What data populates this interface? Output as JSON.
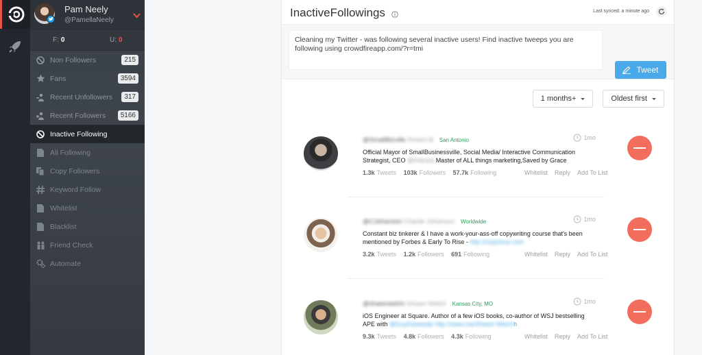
{
  "sidebar": {
    "profile": {
      "name": "Pam Neely",
      "handle": "@PamellaNeely"
    },
    "counts": {
      "f_label": "F:",
      "f_value": "0",
      "u_label": "U:",
      "u_value": "0"
    },
    "items": [
      {
        "label": "Non Followers",
        "badge": "215",
        "icon": "blocked-user-icon"
      },
      {
        "label": "Fans",
        "badge": "3594",
        "icon": "star-icon"
      },
      {
        "label": "Recent Unfollowers",
        "badge": "317",
        "icon": "user-minus-icon"
      },
      {
        "label": "Recent Followers",
        "badge": "5166",
        "icon": "user-plus-icon"
      },
      {
        "label": "Inactive Following",
        "badge": "",
        "icon": "ban-icon",
        "active": true
      },
      {
        "label": "All Following",
        "badge": "",
        "icon": "document-icon"
      },
      {
        "label": "Copy Followers",
        "badge": "",
        "icon": "copy-icon"
      },
      {
        "label": "Keyword Follow",
        "badge": "",
        "icon": "hashtag-icon"
      },
      {
        "label": "Whitelist",
        "badge": "",
        "icon": "whitelist-icon"
      },
      {
        "label": "Blacklist",
        "badge": "",
        "icon": "blacklist-icon"
      },
      {
        "label": "Friend Check",
        "badge": "",
        "icon": "friends-icon"
      },
      {
        "label": "Automate",
        "badge": "",
        "icon": "gears-icon"
      }
    ]
  },
  "header": {
    "title": "InactiveFollowings",
    "synced": "Last synced: a minute ago"
  },
  "compose": {
    "text": "Cleaning my Twitter - was following several inactive users! Find inactive tweeps you are following using crowdfireapp.com/?r=tmi",
    "tweet_label": "Tweet"
  },
  "filters": {
    "period": "1 months+",
    "sort": "Oldest first"
  },
  "users": [
    {
      "handle": "@SmallBizville",
      "realname": "Robert B",
      "location": "San Antonio",
      "time": "1mo",
      "bio_pre": "Official Mayor of SmallBusinessville, Social Media/ Interactive Communication Strategist, CEO ",
      "bio_blur": "@Interest",
      "bio_post": " Master of ALL things marketing,Saved by Grace",
      "tweets": "1.3k",
      "followers": "103k",
      "following": "57.7k"
    },
    {
      "handle": "@CJohanson",
      "realname": "Charlie Johanson",
      "location": "Worldwide",
      "time": "1mo",
      "bio_pre": "Constant biz tinkerer & I have a work-your-ass-off copywriting course that's been mentioned by Forbes & Early To Rise - ",
      "bio_blur": "http://copyhour.com",
      "bio_post": "",
      "tweets": "3.2k",
      "followers": "1.2k",
      "following": "691"
    },
    {
      "handle": "@shawnwelch",
      "realname": "Shawn Welch",
      "location": "Kansas City, MO",
      "time": "1mo",
      "bio_pre": "iOS Engineer at Square. Author of a few iOS books, co-author of WSJ bestselling APE with ",
      "bio_blur": "@GuyKawasaki http://www.me/Shawn-Welch",
      "bio_post": "h",
      "tweets": "9.3k",
      "followers": "4.8k",
      "following": "4.3k"
    }
  ],
  "labels": {
    "tweets": "Tweets",
    "followers": "Followers",
    "following": "Following",
    "whitelist": "Whitelist",
    "reply": "Reply",
    "add_to_list": "Add To List"
  },
  "colors": {
    "accent_red": "#f26d5b",
    "tweet_blue": "#4aa9e8",
    "location_green": "#2aa05c"
  }
}
